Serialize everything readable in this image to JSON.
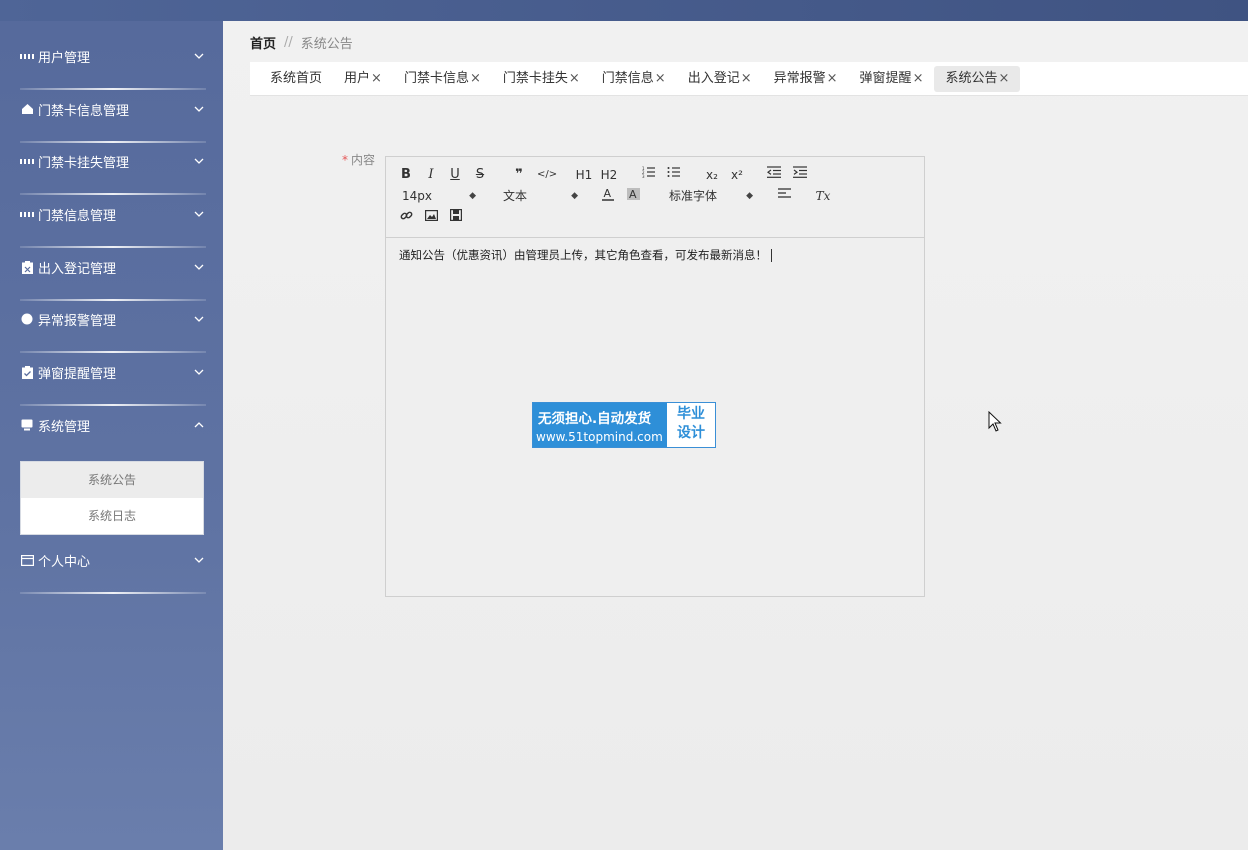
{
  "sidebar": {
    "items": [
      {
        "label": "用户管理",
        "icon": "grid-icon",
        "expanded": false
      },
      {
        "label": "门禁卡信息管理",
        "icon": "home-icon",
        "expanded": false
      },
      {
        "label": "门禁卡挂失管理",
        "icon": "grid-icon",
        "expanded": false
      },
      {
        "label": "门禁信息管理",
        "icon": "grid-icon",
        "expanded": false
      },
      {
        "label": "出入登记管理",
        "icon": "clipboard-icon",
        "expanded": false
      },
      {
        "label": "异常报警管理",
        "icon": "circle-icon",
        "expanded": false
      },
      {
        "label": "弹窗提醒管理",
        "icon": "clipboard-check-icon",
        "expanded": false
      },
      {
        "label": "系统管理",
        "icon": "monitor-icon",
        "expanded": true
      },
      {
        "label": "个人中心",
        "icon": "card-icon",
        "expanded": false
      }
    ],
    "submenu": [
      {
        "label": "系统公告",
        "active": true
      },
      {
        "label": "系统日志",
        "active": false
      }
    ]
  },
  "breadcrumb": {
    "home": "首页",
    "separator": "//",
    "current": "系统公告"
  },
  "tabs": [
    {
      "label": "系统首页",
      "closable": false
    },
    {
      "label": "用户",
      "closable": true
    },
    {
      "label": "门禁卡信息",
      "closable": true
    },
    {
      "label": "门禁卡挂失",
      "closable": true
    },
    {
      "label": "门禁信息",
      "closable": true
    },
    {
      "label": "出入登记",
      "closable": true
    },
    {
      "label": "异常报警",
      "closable": true
    },
    {
      "label": "弹窗提醒",
      "closable": true
    },
    {
      "label": "系统公告",
      "closable": true,
      "active": true
    }
  ],
  "tab_close_glyph": "×",
  "form": {
    "required_mark": "*",
    "content_label": "内容",
    "editor": {
      "font_size": "14px",
      "block_format": "文本",
      "font_family": "标准字体",
      "buttons": {
        "bold": "B",
        "italic": "I",
        "underline": "U",
        "strike": "S",
        "quote": "❞",
        "code": "</>",
        "h1": "H1",
        "h2": "H2",
        "subscript": "x₂",
        "superscript": "x²",
        "clean": "Tx"
      },
      "content": "通知公告（优惠资讯）由管理员上传，其它角色查看，可发布最新消息！"
    }
  },
  "watermark": {
    "line1": "无须担心.自动发货",
    "line2": "www.51topmind.com",
    "right1": "毕业",
    "right2": "设计"
  },
  "colors": {
    "sidebar": "#5a6e9f",
    "accent_blue": "#2e8fd8",
    "required": "#e45656"
  }
}
